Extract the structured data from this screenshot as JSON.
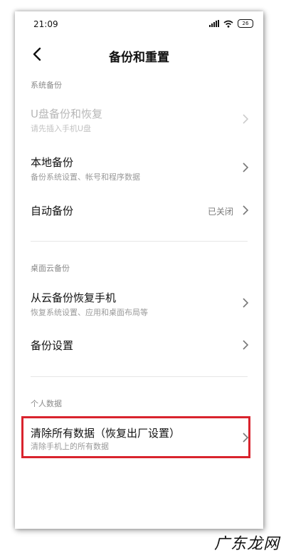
{
  "status_bar": {
    "time": "21:09",
    "battery": "26"
  },
  "header": {
    "title": "备份和重置"
  },
  "sections": {
    "system_backup": {
      "title": "系统备份",
      "items": [
        {
          "title": "U盘备份和恢复",
          "subtitle": "请先插入手机U盘"
        },
        {
          "title": "本地备份",
          "subtitle": "备份系统设置、帐号和程序数据"
        },
        {
          "title": "自动备份",
          "value": "已关闭"
        }
      ]
    },
    "cloud_backup": {
      "title": "桌面云备份",
      "items": [
        {
          "title": "从云备份恢复手机",
          "subtitle": "恢复系统设置、应用和桌面布局等"
        },
        {
          "title": "备份设置"
        }
      ]
    },
    "personal_data": {
      "title": "个人数据",
      "items": [
        {
          "title": "清除所有数据（恢复出厂设置）",
          "subtitle": "清除手机上的所有数据"
        }
      ]
    }
  },
  "watermark": "广东龙网",
  "colors": {
    "highlight_border": "#d9232d",
    "muted_text": "#9a9a9a"
  }
}
